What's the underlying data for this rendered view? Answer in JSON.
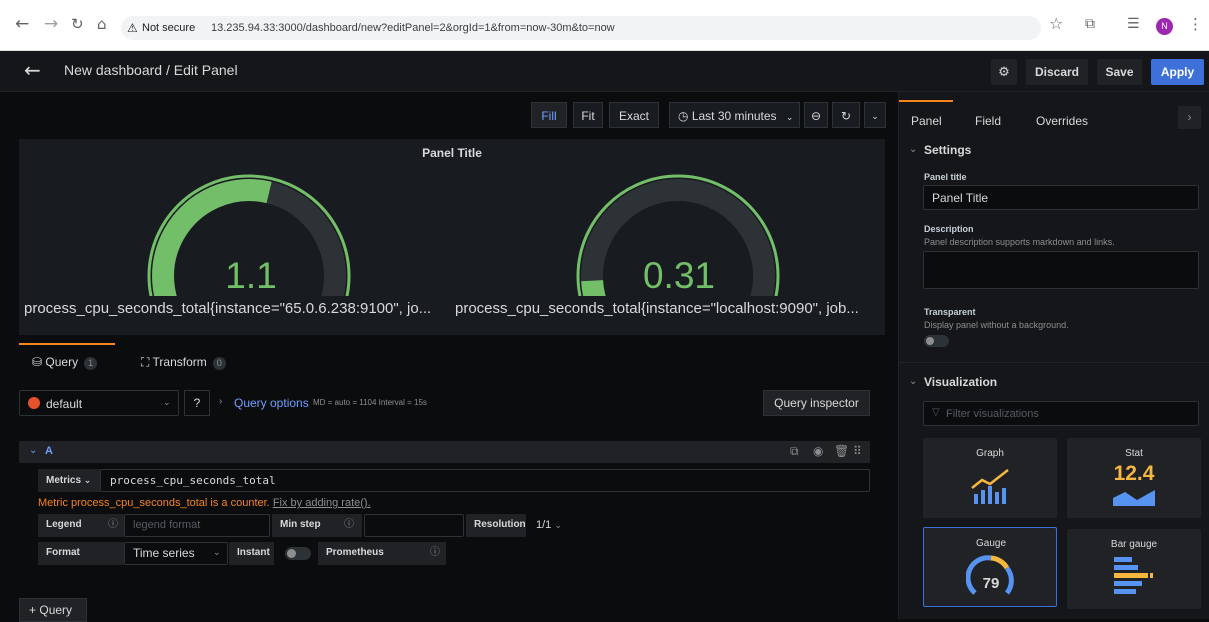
{
  "browser": {
    "security_label": "Not secure",
    "url": "13.235.94.33:3000/dashboard/new?editPanel=2&orgId=1&from=now-30m&to=now",
    "avatar_letter": "N"
  },
  "header": {
    "title": "New dashboard / Edit Panel",
    "discard": "Discard",
    "save": "Save",
    "apply": "Apply"
  },
  "view_toolbar": {
    "fill": "Fill",
    "fit": "Fit",
    "exact": "Exact",
    "time_range": "Last 30 minutes"
  },
  "panel": {
    "title": "Panel Title",
    "gauges": [
      {
        "value": "1.1",
        "fraction": 0.55,
        "label": "process_cpu_seconds_total{instance=\"65.0.6.238:9100\", jo..."
      },
      {
        "value": "0.31",
        "fraction": 0.155,
        "label": "process_cpu_seconds_total{instance=\"localhost:9090\", job..."
      }
    ],
    "gauge_color": "#73bf69",
    "track_color": "#2c3235"
  },
  "query_tabs": {
    "query_label": "Query",
    "query_count": "1",
    "transform_label": "Transform",
    "transform_count": "0"
  },
  "datasource": {
    "name": "default",
    "query_options": "Query options",
    "options_detail": "MD = auto = 1104   Interval = 15s",
    "inspector": "Query inspector"
  },
  "query": {
    "ref": "A",
    "metrics_label": "Metrics",
    "metrics_value": "process_cpu_seconds_total",
    "warning": "Metric process_cpu_seconds_total is a counter.",
    "warning_link": "Fix by adding rate().",
    "legend_label": "Legend",
    "legend_placeholder": "legend format",
    "minstep_label": "Min step",
    "resolution_label": "Resolution",
    "resolution_value": "1/1",
    "format_label": "Format",
    "format_value": "Time series",
    "instant_label": "Instant",
    "prometheus_label": "Prometheus",
    "add_query": "Query"
  },
  "options_pane": {
    "tabs": [
      "Panel",
      "Field",
      "Overrides"
    ],
    "settings": "Settings",
    "panel_title_label": "Panel title",
    "panel_title_value": "Panel Title",
    "description_label": "Description",
    "description_hint": "Panel description supports markdown and links.",
    "transparent_label": "Transparent",
    "transparent_hint": "Display panel without a background.",
    "visualization": "Visualization",
    "filter_placeholder": "Filter visualizations",
    "viz": [
      {
        "name": "Graph"
      },
      {
        "name": "Stat",
        "sample": "12.4"
      },
      {
        "name": "Gauge",
        "sample": "79"
      },
      {
        "name": "Bar gauge"
      }
    ]
  }
}
